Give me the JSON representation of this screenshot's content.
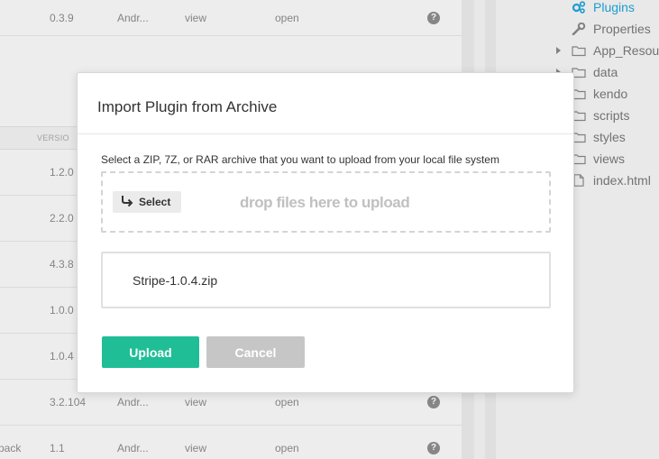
{
  "table": {
    "header_version": "VERSIO",
    "rows": [
      {
        "name": "",
        "version": "0.3.9",
        "author": "Andr...",
        "view": "view",
        "open": "open",
        "help": "?"
      },
      {
        "name": "",
        "version": "1.2.0",
        "author": "",
        "view": "",
        "open": "",
        "help": ""
      },
      {
        "name": "",
        "version": "2.2.0",
        "author": "",
        "view": "",
        "open": "",
        "help": ""
      },
      {
        "name": "",
        "version": "4.3.8",
        "author": "",
        "view": "",
        "open": "",
        "help": ""
      },
      {
        "name": "",
        "version": "1.0.0",
        "author": "",
        "view": "",
        "open": "",
        "help": ""
      },
      {
        "name": "",
        "version": "1.0.4",
        "author": "",
        "view": "",
        "open": "",
        "help": ""
      },
      {
        "name": "",
        "version": "3.2.104",
        "author": "Andr...",
        "view": "view",
        "open": "open",
        "help": "?"
      },
      {
        "name": "pack",
        "version": "1.1",
        "author": "Andr...",
        "view": "view",
        "open": "open",
        "help": "?"
      }
    ]
  },
  "tree": {
    "items": [
      {
        "label": "Plugins",
        "icon": "gears-icon",
        "active": true
      },
      {
        "label": "Properties",
        "icon": "wrench-icon"
      },
      {
        "label": "App_Resou",
        "icon": "folder-icon",
        "expandable": true
      },
      {
        "label": "data",
        "icon": "folder-icon",
        "expandable": true
      },
      {
        "label": "kendo",
        "icon": "folder-icon"
      },
      {
        "label": "scripts",
        "icon": "folder-icon"
      },
      {
        "label": "styles",
        "icon": "folder-icon"
      },
      {
        "label": "views",
        "icon": "folder-icon"
      },
      {
        "label": "index.html",
        "icon": "file-icon"
      }
    ]
  },
  "dialog": {
    "title": "Import Plugin from Archive",
    "description": "Select a ZIP, 7Z, or RAR archive that you want to upload from your local file system",
    "select_label": "Select",
    "drop_text": "drop files here to upload",
    "file_name": "Stripe-1.0.4.zip",
    "upload_label": "Upload",
    "cancel_label": "Cancel"
  },
  "colors": {
    "upload": "#1fbe97",
    "cancel": "#c6c6c6",
    "active_tree": "#1fa3d8"
  }
}
